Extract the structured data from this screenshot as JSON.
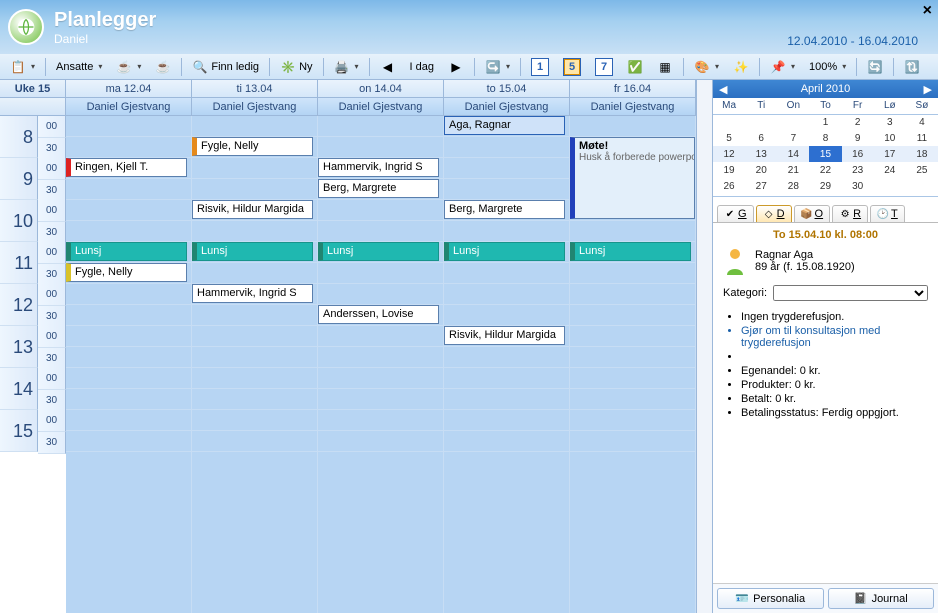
{
  "header": {
    "title": "Planlegger",
    "user": "Daniel",
    "range": "12.04.2010 - 16.04.2010",
    "close_label": "×"
  },
  "toolbar": {
    "ansatte": "Ansatte",
    "finn_ledig": "Finn ledig",
    "ny": "Ny",
    "idag": "I dag",
    "zoom": "100%",
    "view_buttons": [
      "1",
      "5",
      "7"
    ]
  },
  "cal": {
    "week_label": "Uke 15",
    "days": [
      "ma 12.04",
      "ti 13.04",
      "on 14.04",
      "to 15.04",
      "fr 16.04"
    ],
    "resource": "Daniel Gjestvang",
    "hours": [
      "8",
      "9",
      "10",
      "11",
      "12",
      "13",
      "14",
      "15"
    ],
    "halves": [
      "00",
      "30"
    ]
  },
  "events": {
    "lunch": "Lunsj",
    "aga": "Aga, Ragnar",
    "fygle": "Fygle, Nelly",
    "ringen": "Ringen, Kjell T.",
    "hammervik": "Hammervik, Ingrid S",
    "berg": "Berg, Margrete",
    "risvik": "Risvik, Hildur Margida",
    "anderssen": "Anderssen, Lovise",
    "mote_title": "Møte!",
    "mote_desc": "Husk å forberede powerpoit presentasjon"
  },
  "month": {
    "title": "April 2010",
    "dow": [
      "Ma",
      "Ti",
      "On",
      "To",
      "Fr",
      "Lø",
      "Sø"
    ],
    "today": 15,
    "prev_tail": [],
    "grid": [
      [
        "",
        "",
        "",
        "1",
        "2",
        "3",
        "4"
      ],
      [
        "5",
        "6",
        "7",
        "8",
        "9",
        "10",
        "11"
      ],
      [
        "12",
        "13",
        "14",
        "15",
        "16",
        "17",
        "18"
      ],
      [
        "19",
        "20",
        "21",
        "22",
        "23",
        "24",
        "25"
      ],
      [
        "26",
        "27",
        "28",
        "29",
        "30",
        "",
        ""
      ]
    ]
  },
  "tabs": {
    "g": "G",
    "d": "D",
    "o": "O",
    "r": "R",
    "t": "T"
  },
  "detail": {
    "when": "To 15.04.10 kl. 08:00",
    "name": "Ragnar Aga",
    "age": "89 år (f. 15.08.1920)",
    "kategori_label": "Kategori:",
    "items": {
      "i0": "Ingen trygderefusjon.",
      "i1": "Gjør om til konsultasjon med trygderefusjon",
      "i2": "Egenandel: 0 kr.",
      "i3": "Produkter: 0 kr.",
      "i4": "Betalt: 0 kr.",
      "i5": "Betalingsstatus: Ferdig oppgjort."
    }
  },
  "bottom": {
    "personalia": "Personalia",
    "journal": "Journal"
  }
}
